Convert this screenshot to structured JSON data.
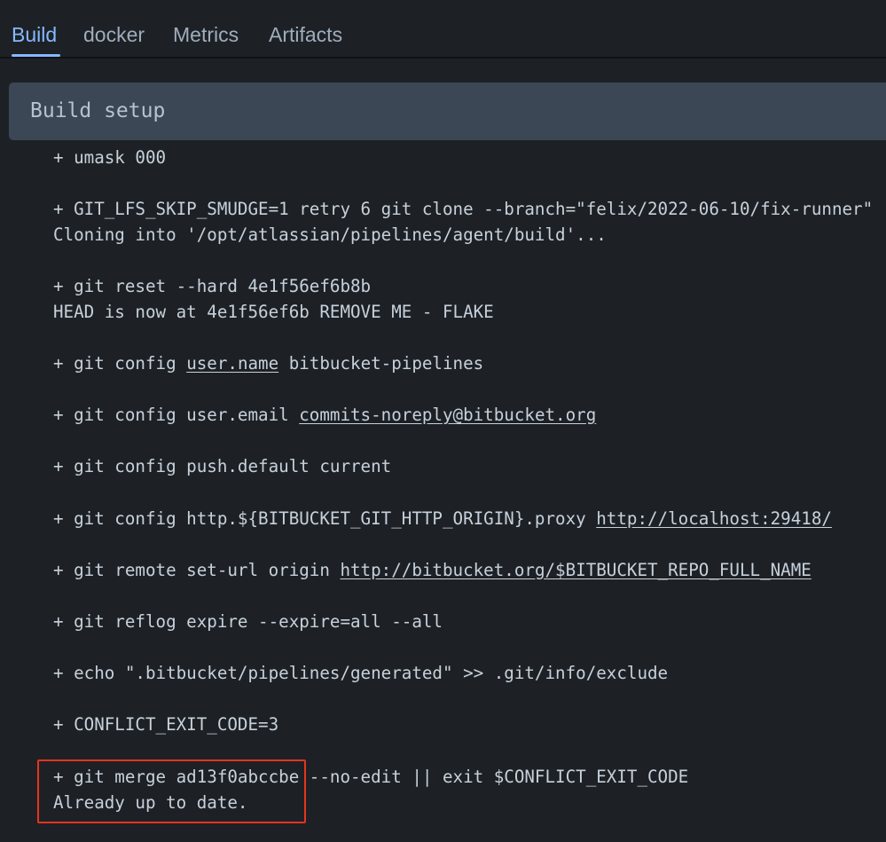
{
  "tabs": [
    {
      "label": "Build",
      "active": true
    },
    {
      "label": "docker",
      "active": false
    },
    {
      "label": "Metrics",
      "active": false
    },
    {
      "label": "Artifacts",
      "active": false
    }
  ],
  "section": {
    "title": "Build setup"
  },
  "log": {
    "umask": "+ umask 000",
    "clone_cmd": "+ GIT_LFS_SKIP_SMUDGE=1 retry 6 git clone --branch=\"felix/2022-06-10/fix-runner\"",
    "clone_out": "Cloning into '/opt/atlassian/pipelines/agent/build'...",
    "reset_cmd": "+ git reset --hard 4e1f56ef6b8b",
    "reset_out": "HEAD is now at 4e1f56ef6b REMOVE ME - FLAKE",
    "config_name_pre": "+ git config ",
    "config_name_link": "user.name",
    "config_name_post": " bitbucket-pipelines",
    "config_email_pre": "+ git config user.email ",
    "config_email_link": "commits-noreply@bitbucket.org",
    "config_push": "+ git config push.default current",
    "config_proxy_pre": "+ git config http.${BITBUCKET_GIT_HTTP_ORIGIN}.proxy ",
    "config_proxy_link": "http://localhost:29418/",
    "remote_pre": "+ git remote set-url origin ",
    "remote_link": "http://bitbucket.org/$BITBUCKET_REPO_FULL_NAME",
    "reflog": "+ git reflog expire --expire=all --all",
    "echo": "+ echo \".bitbucket/pipelines/generated\" >> .git/info/exclude",
    "conflict": "+ CONFLICT_EXIT_CODE=3",
    "merge_cmd": "+ git merge ad13f0abccbe --no-edit || exit $CONFLICT_EXIT_CODE",
    "merge_out": "Already up to date."
  },
  "colors": {
    "background": "#1d2125",
    "header": "#3b4754",
    "accent": "#85b8ff",
    "highlight": "#e5341f"
  }
}
